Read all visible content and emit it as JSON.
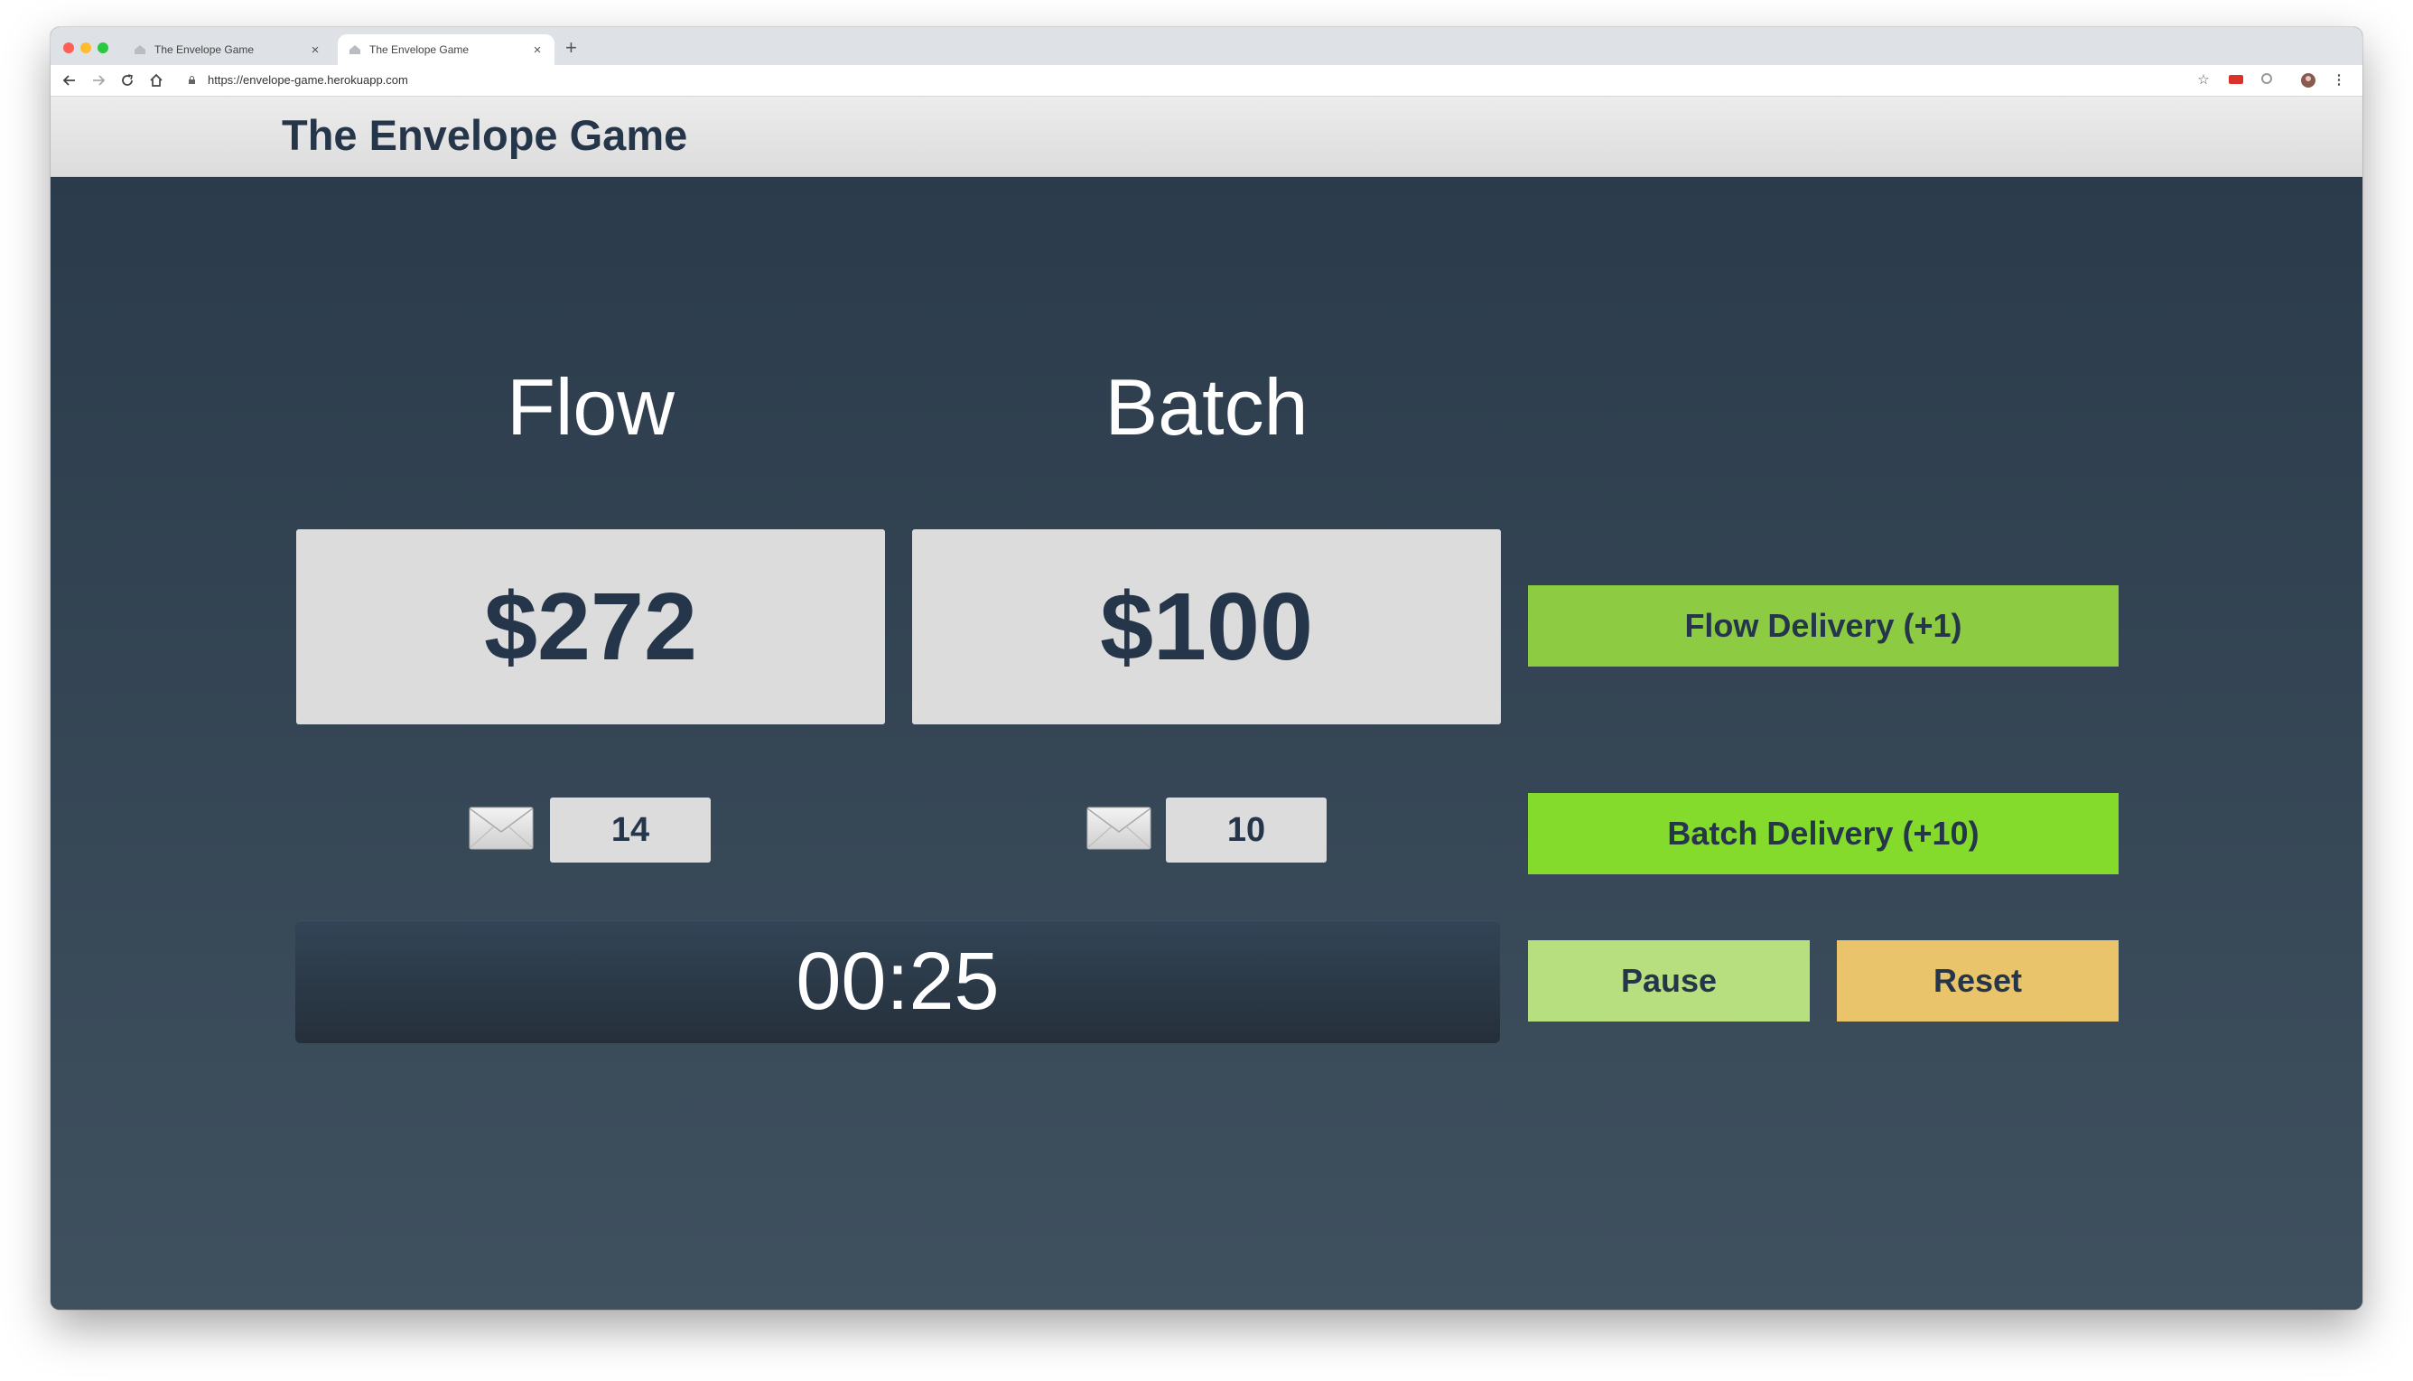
{
  "browser": {
    "tabs": [
      {
        "title": "The Envelope Game",
        "active": false
      },
      {
        "title": "The Envelope Game",
        "active": true
      }
    ],
    "new_tab_glyph": "+",
    "close_glyph": "×",
    "url": "https://envelope-game.herokuapp.com"
  },
  "page": {
    "title": "The Envelope Game"
  },
  "game": {
    "flow": {
      "label": "Flow",
      "money": "$272",
      "envelopes": "14"
    },
    "batch": {
      "label": "Batch",
      "money": "$100",
      "envelopes": "10"
    },
    "timer": "00:25"
  },
  "controls": {
    "flow_delivery_label": "Flow Delivery (+1)",
    "batch_delivery_label": "Batch Delivery (+10)",
    "pause_label": "Pause",
    "reset_label": "Reset"
  },
  "colors": {
    "flow_delivery": "#8dcc42",
    "batch_delivery": "#85db2c",
    "pause": "#b7df80",
    "reset": "#e9c46a",
    "text_dark": "#25364a"
  },
  "icons": {
    "envelope": "envelope-icon"
  }
}
